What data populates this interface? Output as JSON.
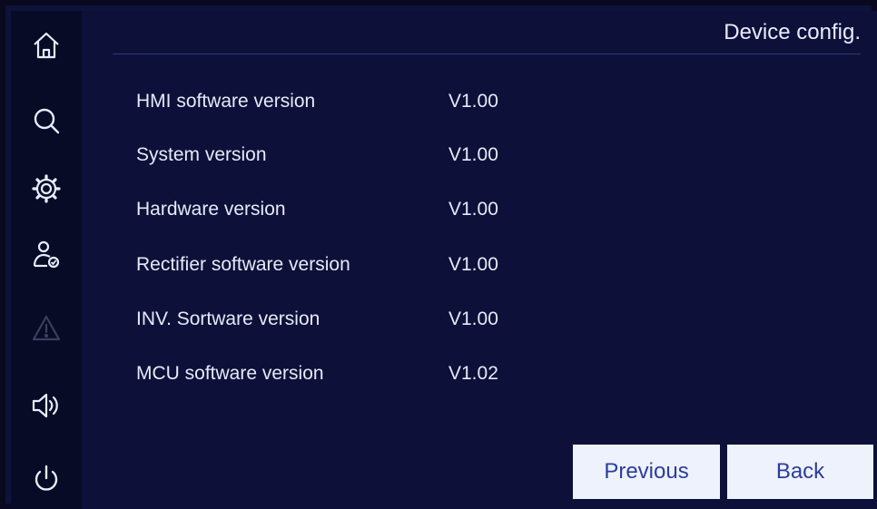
{
  "header": {
    "title": "Device config."
  },
  "sidebar": {
    "items": [
      {
        "icon": "home-icon",
        "enabled": true
      },
      {
        "icon": "search-icon",
        "enabled": true
      },
      {
        "icon": "gear-icon",
        "enabled": true
      },
      {
        "icon": "user-check-icon",
        "enabled": true
      },
      {
        "icon": "warning-icon",
        "enabled": false
      },
      {
        "icon": "speaker-icon",
        "enabled": true
      },
      {
        "icon": "power-icon",
        "enabled": true
      }
    ]
  },
  "versions": [
    {
      "label": "HMI software version",
      "value": "V1.00"
    },
    {
      "label": "System version",
      "value": "V1.00"
    },
    {
      "label": "Hardware version",
      "value": "V1.00"
    },
    {
      "label": "Rectifier software version",
      "value": "V1.00"
    },
    {
      "label": "INV. Sortware version",
      "value": "V1.00"
    },
    {
      "label": "MCU software version",
      "value": "V1.02"
    }
  ],
  "buttons": {
    "previous": "Previous",
    "back": "Back"
  },
  "colors": {
    "background": "#0d1139",
    "sidebar": "#080b25",
    "text": "#e6e9f7",
    "button_bg": "#eef2fc",
    "button_text": "#2b3d9c",
    "icon": "#e8ecff",
    "icon_disabled": "#3a3f5e"
  }
}
